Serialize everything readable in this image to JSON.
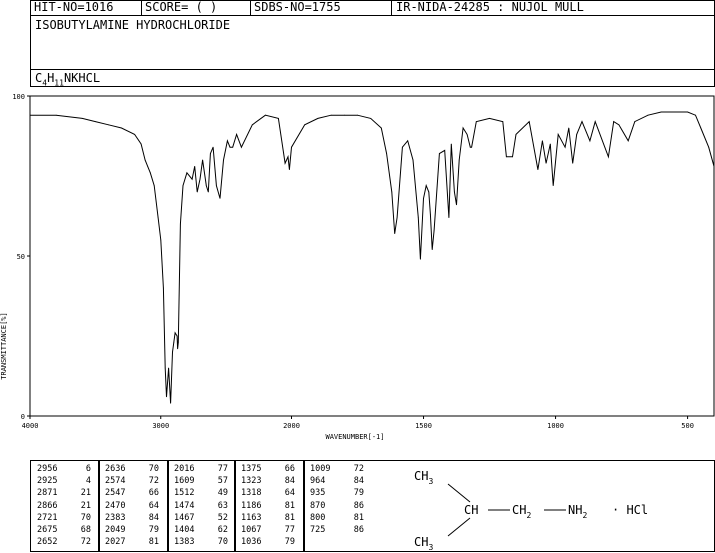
{
  "header": {
    "hit_no": "HIT-NO=1016",
    "score": "SCORE=  (   )",
    "sdbs_no": "SDBS-NO=1755",
    "ir_id": "IR-NIDA-24285 : NUJOL MULL"
  },
  "compound_name": "ISOBUTYLAMINE HYDROCHLORIDE",
  "formula": {
    "c": "C",
    "c_n": "4",
    "h": "H",
    "h_n": "11",
    "rest": "NKHCL"
  },
  "chart_data": {
    "type": "line",
    "xlabel": "WAVENUMBER[-1]",
    "ylabel": "TRANSMITTANCE[%]",
    "xlim": [
      4000,
      400
    ],
    "ylim": [
      0,
      100
    ],
    "xticks": [
      "4000",
      "3000",
      "2000",
      "1500",
      "1000",
      "500"
    ],
    "yticks": [
      "100",
      "50",
      "0"
    ],
    "x": [
      4000,
      3800,
      3600,
      3500,
      3400,
      3300,
      3200,
      3150,
      3120,
      3100,
      3080,
      3050,
      3020,
      3000,
      2980,
      2966,
      2956,
      2940,
      2925,
      2910,
      2900,
      2890,
      2875,
      2871,
      2866,
      2850,
      2830,
      2800,
      2760,
      2740,
      2721,
      2700,
      2680,
      2652,
      2636,
      2620,
      2600,
      2574,
      2547,
      2520,
      2490,
      2470,
      2450,
      2420,
      2383,
      2300,
      2200,
      2100,
      2049,
      2027,
      2016,
      2000,
      1950,
      1900,
      1850,
      1800,
      1750,
      1700,
      1660,
      1640,
      1620,
      1609,
      1600,
      1580,
      1560,
      1540,
      1520,
      1512,
      1500,
      1490,
      1480,
      1474,
      1467,
      1460,
      1440,
      1420,
      1404,
      1395,
      1383,
      1375,
      1365,
      1350,
      1335,
      1323,
      1318,
      1300,
      1250,
      1200,
      1186,
      1163,
      1150,
      1100,
      1067,
      1050,
      1036,
      1020,
      1009,
      990,
      964,
      950,
      935,
      920,
      900,
      870,
      850,
      800,
      780,
      760,
      725,
      700,
      650,
      600,
      550,
      500,
      470,
      450,
      420,
      400
    ],
    "y": [
      94,
      94,
      93,
      92,
      91,
      90,
      88,
      85,
      80,
      78,
      76,
      72,
      62,
      55,
      40,
      15,
      6,
      15,
      4,
      20,
      23,
      26,
      25,
      21,
      23,
      60,
      72,
      76,
      74,
      78,
      70,
      74,
      80,
      72,
      70,
      82,
      84,
      72,
      68,
      80,
      86,
      84,
      84,
      88,
      84,
      91,
      94,
      93,
      79,
      81,
      77,
      84,
      91,
      93,
      94,
      94,
      94,
      93,
      90,
      82,
      70,
      57,
      62,
      84,
      86,
      80,
      62,
      49,
      68,
      72,
      70,
      63,
      52,
      58,
      82,
      83,
      62,
      85,
      70,
      66,
      80,
      90,
      88,
      84,
      84,
      92,
      93,
      92,
      81,
      81,
      88,
      92,
      77,
      86,
      79,
      85,
      72,
      88,
      84,
      90,
      79,
      88,
      92,
      86,
      92,
      81,
      92,
      91,
      86,
      92,
      94,
      95,
      95,
      95,
      94,
      90,
      84,
      78
    ]
  },
  "peak_table": [
    [
      "2956",
      "6"
    ],
    [
      "2925",
      "4"
    ],
    [
      "2871",
      "21"
    ],
    [
      "2866",
      "21"
    ],
    [
      "2721",
      "70"
    ],
    [
      "2675",
      "68"
    ],
    [
      "2652",
      "72"
    ],
    [
      "2636",
      "70"
    ],
    [
      "2574",
      "72"
    ],
    [
      "2547",
      "66"
    ],
    [
      "2470",
      "64"
    ],
    [
      "2383",
      "84"
    ],
    [
      "2049",
      "79"
    ],
    [
      "2027",
      "81"
    ],
    [
      "2016",
      "77"
    ],
    [
      "1609",
      "57"
    ],
    [
      "1512",
      "49"
    ],
    [
      "1474",
      "63"
    ],
    [
      "1467",
      "52"
    ],
    [
      "1404",
      "62"
    ],
    [
      "1383",
      "70"
    ],
    [
      "1375",
      "66"
    ],
    [
      "1323",
      "84"
    ],
    [
      "1318",
      "64"
    ],
    [
      "1186",
      "81"
    ],
    [
      "1163",
      "81"
    ],
    [
      "1067",
      "77"
    ],
    [
      "1036",
      "79"
    ],
    [
      "1009",
      "72"
    ],
    [
      "964",
      "84"
    ],
    [
      "935",
      "79"
    ],
    [
      "870",
      "86"
    ],
    [
      "800",
      "81"
    ],
    [
      "725",
      "86"
    ]
  ],
  "structure": {
    "ch3_top": "CH",
    "ch3_top_sub": "3",
    "ch": "CH",
    "ch2": "CH",
    "ch2_sub": "2",
    "nh2": "NH",
    "nh2_sub": "2",
    "hcl": "· HCl",
    "ch3_bot": "CH",
    "ch3_bot_sub": "3"
  },
  "colors": {
    "line": "#000000",
    "background": "#ffffff"
  }
}
